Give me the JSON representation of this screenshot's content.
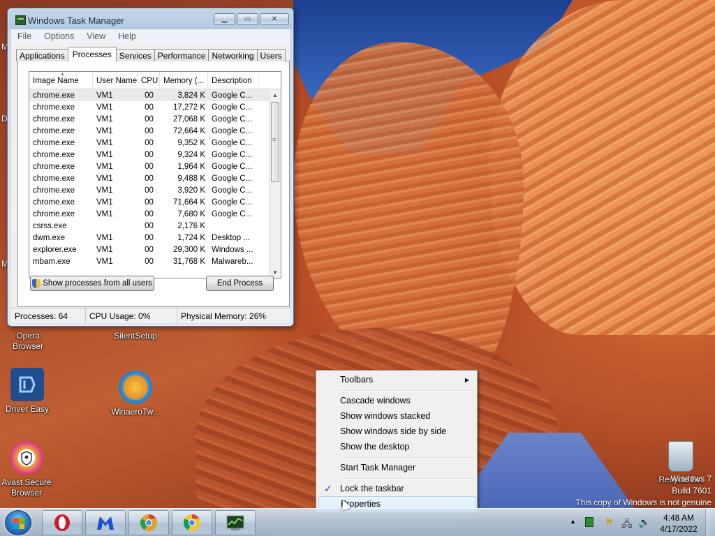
{
  "desktop": {
    "icons": [
      {
        "label": "Opera\nBrowser",
        "line1": "Opera",
        "line2": "Browser"
      },
      {
        "label": "SilentSetup"
      },
      {
        "label": "Driver Easy"
      },
      {
        "label": "WinaeroTw..."
      },
      {
        "line1": "Avast Secure",
        "line2": "Browser"
      },
      {
        "label": "Recycle Bin"
      }
    ],
    "edge_letters": [
      "M",
      "D",
      "M"
    ],
    "watermark": {
      "line1": "Windows 7",
      "line2": "Build 7601",
      "line3": "This copy of Windows is not genuine"
    }
  },
  "task_manager": {
    "title": "Windows Task Manager",
    "menu": [
      "File",
      "Options",
      "View",
      "Help"
    ],
    "tabs": [
      "Applications",
      "Processes",
      "Services",
      "Performance",
      "Networking",
      "Users"
    ],
    "active_tab": "Processes",
    "columns": [
      "Image Name",
      "User Name",
      "CPU",
      "Memory (...",
      "Description"
    ],
    "rows": [
      [
        "chrome.exe",
        "VM1",
        "00",
        "3,824 K",
        "Google C..."
      ],
      [
        "chrome.exe",
        "VM1",
        "00",
        "17,272 K",
        "Google C..."
      ],
      [
        "chrome.exe",
        "VM1",
        "00",
        "27,068 K",
        "Google C..."
      ],
      [
        "chrome.exe",
        "VM1",
        "00",
        "72,664 K",
        "Google C..."
      ],
      [
        "chrome.exe",
        "VM1",
        "00",
        "9,352 K",
        "Google C..."
      ],
      [
        "chrome.exe",
        "VM1",
        "00",
        "9,324 K",
        "Google C..."
      ],
      [
        "chrome.exe",
        "VM1",
        "00",
        "1,964 K",
        "Google C..."
      ],
      [
        "chrome.exe",
        "VM1",
        "00",
        "9,488 K",
        "Google C..."
      ],
      [
        "chrome.exe",
        "VM1",
        "00",
        "3,920 K",
        "Google C..."
      ],
      [
        "chrome.exe",
        "VM1",
        "00",
        "71,664 K",
        "Google C..."
      ],
      [
        "chrome.exe",
        "VM1",
        "00",
        "7,680 K",
        "Google C..."
      ],
      [
        "csrss.exe",
        "",
        "00",
        "2,176 K",
        ""
      ],
      [
        "dwm.exe",
        "VM1",
        "00",
        "1,724 K",
        "Desktop ..."
      ],
      [
        "explorer.exe",
        "VM1",
        "00",
        "29,300 K",
        "Windows ..."
      ],
      [
        "mbam.exe",
        "VM1",
        "00",
        "31,768 K",
        "Malwareb..."
      ]
    ],
    "show_all_button": "Show processes from all users",
    "end_process_button": "End Process",
    "status": {
      "processes": "Processes: 64",
      "cpu": "CPU Usage: 0%",
      "memory": "Physical Memory: 26%"
    }
  },
  "context_menu": {
    "toolbars": "Toolbars",
    "cascade": "Cascade windows",
    "stacked": "Show windows stacked",
    "side_by_side": "Show windows side by side",
    "show_desktop": "Show the desktop",
    "start_tm": "Start Task Manager",
    "lock": "Lock the taskbar",
    "lock_checked": true,
    "properties": "Properties"
  },
  "taskbar": {
    "pinned": [
      "opera-icon",
      "malwarebytes-icon",
      "chrome-canary-icon",
      "chrome-icon",
      "task-manager-icon"
    ],
    "clock_time": "4:48 AM",
    "clock_date": "4/17/2022"
  },
  "colors": {
    "accent": "#2f7ec7",
    "opera_red": "#d11a21",
    "malwarebytes_blue": "#1c4fd0"
  }
}
